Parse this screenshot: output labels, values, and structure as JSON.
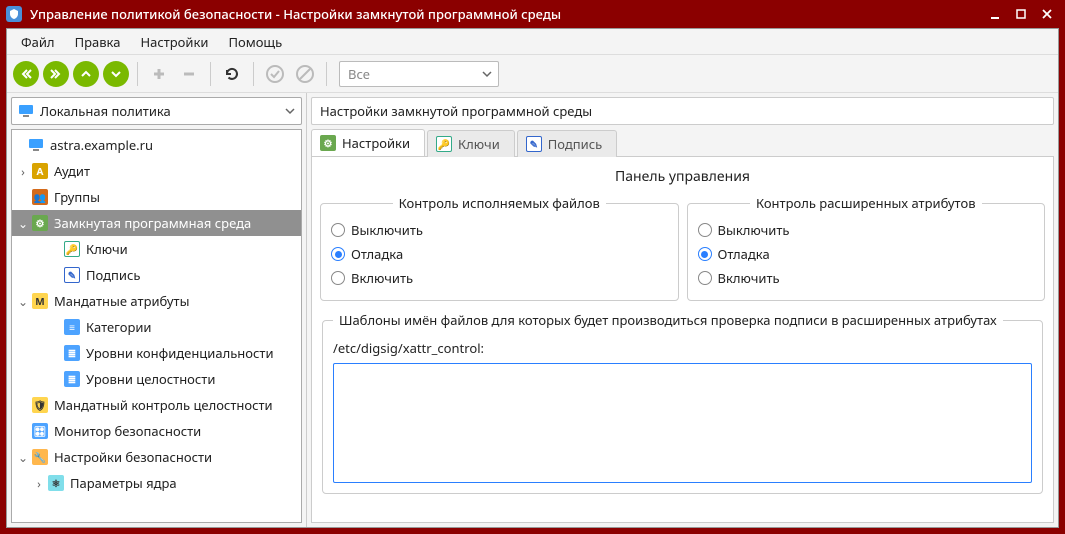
{
  "titlebar": {
    "title": "Управление политикой безопасности - Настройки замкнутой программной среды"
  },
  "menu": {
    "file": "Файл",
    "edit": "Правка",
    "settings": "Настройки",
    "help": "Помощь"
  },
  "toolbar": {
    "filter_value": "Все"
  },
  "policy_combo": {
    "label": "Локальная политика"
  },
  "tree": {
    "host": "astra.example.ru",
    "audit": "Аудит",
    "groups": "Группы",
    "closed_env": "Замкнутая программная среда",
    "closed_env_children": {
      "keys": "Ключи",
      "sign": "Подпись"
    },
    "mand_attrs": "Мандатные атрибуты",
    "mand_attrs_children": {
      "categories": "Категории",
      "conf_levels": "Уровни конфиденциальности",
      "integ_levels": "Уровни целостности"
    },
    "mic": "Мандатный контроль целостности",
    "sec_monitor": "Монитор безопасности",
    "sec_settings": "Настройки безопасности",
    "sec_settings_children": {
      "kernel_params": "Параметры ядра"
    }
  },
  "path": "Настройки замкнутой программной среды",
  "tabs": {
    "settings": "Настройки",
    "keys": "Ключи",
    "sign": "Подпись"
  },
  "panel": {
    "title": "Панель управления",
    "exec_ctrl": {
      "legend": "Контроль исполняемых файлов",
      "opt_off": "Выключить",
      "opt_debug": "Отладка",
      "opt_on": "Включить"
    },
    "xattr_ctrl": {
      "legend": "Контроль расширенных атрибутов",
      "opt_off": "Выключить",
      "opt_debug": "Отладка",
      "opt_on": "Включить"
    },
    "templates": {
      "legend": "Шаблоны имён файлов для которых будет производиться проверка подписи в расширенных атрибутах",
      "path": "/etc/digsig/xattr_control:"
    }
  }
}
